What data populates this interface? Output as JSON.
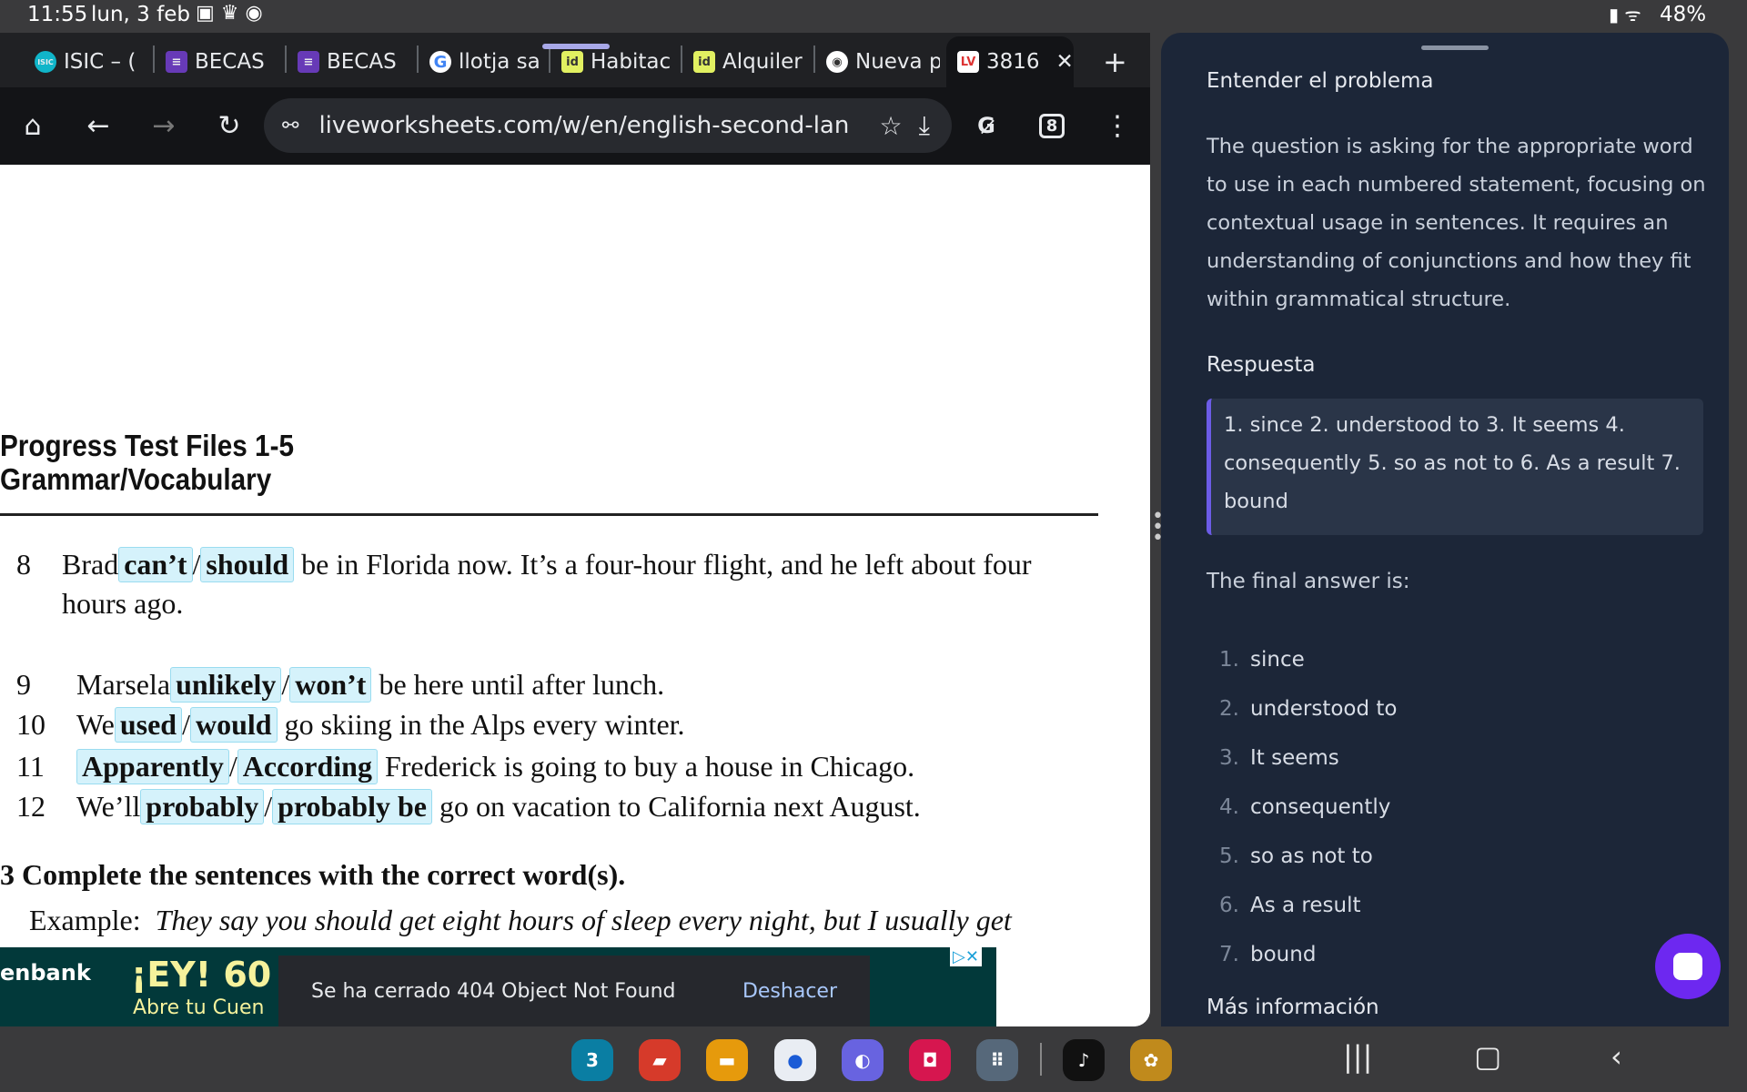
{
  "status": {
    "time": "11:55",
    "date": "lun, 3 feb",
    "battery": "48%"
  },
  "tabs": [
    {
      "label": "ISIC – (",
      "icon": "isic-icon",
      "color": "#10b5c9"
    },
    {
      "label": "BECAS",
      "icon": "forms-icon",
      "color": "#673ab7"
    },
    {
      "label": "BECAS",
      "icon": "forms-icon",
      "color": "#673ab7"
    },
    {
      "label": "llotja sa",
      "icon": "google-icon",
      "color": "#ffffff"
    },
    {
      "label": "Habitac",
      "icon": "idealista-icon",
      "color": "#e1f061"
    },
    {
      "label": "Alquiler",
      "icon": "idealista-icon",
      "color": "#e1f061"
    },
    {
      "label": "Nueva p",
      "icon": "chrome-icon",
      "color": "#ffffff"
    },
    {
      "label": "3816",
      "icon": "liveworksheets-icon",
      "color": "#ffffff",
      "active": true
    }
  ],
  "toolbar": {
    "url": "liveworksheets.com/w/en/english-second-lan",
    "tab_count": "8"
  },
  "worksheet": {
    "title1": "Progress Test Files 1-5",
    "title2": "Grammar/Vocabulary",
    "items": [
      {
        "num": "8",
        "pre": "Brad",
        "a": "can’t",
        "b": "should",
        "post": "be in Florida now. It’s a four-hour flight, and he left about four",
        "cont": "hours ago."
      },
      {
        "num": "9",
        "pre": "Marsela",
        "a": "unlikely",
        "b": "won’t",
        "post": "be here until after lunch."
      },
      {
        "num": "10",
        "pre": "We",
        "a": "used",
        "b": "would",
        "post": "go skiing in the Alps every winter."
      },
      {
        "num": "11",
        "pre": "",
        "a": "Apparently",
        "b": "According",
        "post": "Frederick is going to buy a house in Chicago."
      },
      {
        "num": "12",
        "pre": "We’ll",
        "a": "probably",
        "b": "probably be",
        "post": "go on vacation to California next August."
      }
    ],
    "section": "3  Complete the sentences with the correct word(s).",
    "example_label": "Example:",
    "example": "They say you should get eight hours of sleep every night, but I usually get"
  },
  "ad": {
    "brand": "enbank",
    "headline": "¡EY! 60",
    "sub": "Abre tu Cuen"
  },
  "toast": {
    "message": "Se ha cerrado 404 Object Not Found",
    "action": "Deshacer"
  },
  "panel": {
    "h1": "Entender el problema",
    "para": "The question is asking for the appropriate word to use in each numbered statement, focusing on contextual usage in sentences. It requires an understanding of conjunctions and how they fit within grammatical structure.",
    "h2": "Respuesta",
    "answer": "1. since 2. understood to 3. It seems 4. consequently 5. so as not to 6. As a result 7. bound",
    "final": "The final answer is:",
    "list": [
      "since",
      "understood to",
      "It seems",
      "consequently",
      "so as not to",
      "As a result",
      "bound"
    ],
    "more": "Más información",
    "accent": "#6d28f0"
  },
  "taskbar": {
    "apps": [
      {
        "name": "calendar-icon",
        "color": "#0a7ea3",
        "glyph": "3"
      },
      {
        "name": "notes-icon",
        "color": "#d63a2a",
        "glyph": "▰"
      },
      {
        "name": "files-icon",
        "color": "#e69a0c",
        "glyph": "▬"
      },
      {
        "name": "messages-icon",
        "color": "#e9edf3",
        "glyph": "●"
      },
      {
        "name": "internet-icon",
        "color": "#6863e0",
        "glyph": "◐"
      },
      {
        "name": "camera-icon",
        "color": "#d6164f",
        "glyph": "◘"
      },
      {
        "name": "apps-grid-icon",
        "color": "#56687a",
        "glyph": "⠿"
      },
      {
        "name": "tiktok-icon",
        "color": "#111111",
        "glyph": "♪"
      },
      {
        "name": "game-icon",
        "color": "#c08a1c",
        "glyph": "✿"
      }
    ]
  }
}
